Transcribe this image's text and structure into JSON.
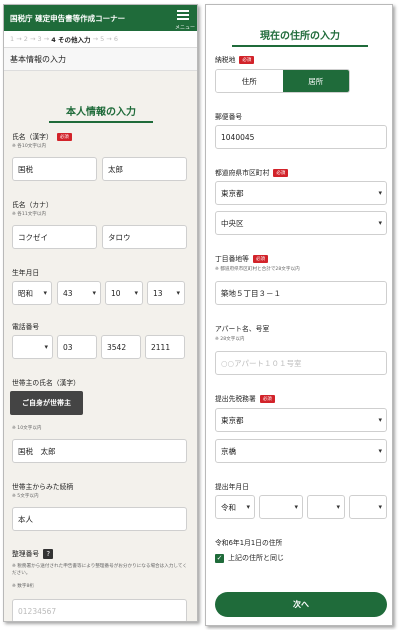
{
  "header": {
    "title": "国税庁 確定申告書等作成コーナー",
    "menu_label": "メニュー"
  },
  "steps": {
    "s1": "1",
    "s2": "2",
    "s3": "3",
    "current": "4 その他入力",
    "s5": "5",
    "s6": "6"
  },
  "section_title": "基本情報の入力",
  "left": {
    "heading": "本人情報の入力",
    "required_badge": "必須",
    "name_kanji": {
      "label": "氏名（漢字）",
      "note": "※ 各10文字以内",
      "last": "国税",
      "first": "太郎"
    },
    "name_kana": {
      "label": "氏名（カナ）",
      "note": "※ 各11文字以内",
      "last": "コクゼイ",
      "first": "タロウ"
    },
    "birthday": {
      "label": "生年月日",
      "era": "昭和",
      "year": "43",
      "month": "10",
      "day": "13"
    },
    "phone": {
      "label": "電話番号",
      "type": "",
      "p1": "03",
      "p2": "3542",
      "p3": "2111"
    },
    "householder": {
      "label": "世帯主の氏名（漢字）",
      "self_button": "ご自身が世帯主",
      "note": "※ 10文字以内",
      "value": "国税　太郎"
    },
    "relation": {
      "label": "世帯主からみた続柄",
      "note": "※ 5文字以内",
      "value": "本人"
    },
    "ref_number": {
      "label": "整理番号",
      "help": "?",
      "note1": "※ 税務署から送付された申告書等により整理番号がお分かりになる場合は入力してください。",
      "note2": "※ 数字8桁",
      "placeholder": "01234567"
    }
  },
  "right": {
    "heading": "現在の住所の入力",
    "required_badge": "必須",
    "tax_place": {
      "label": "納税地",
      "opt1": "住所",
      "opt2": "居所"
    },
    "postal": {
      "label": "郵便番号",
      "value": "1040045"
    },
    "prefecture": {
      "label": "都道府県市区町村",
      "pref": "東京都",
      "city": "中央区"
    },
    "address": {
      "label": "丁目番地等",
      "note": "※ 都道府県市区町村と合計で28文字以内",
      "value": "築地５丁目３－１"
    },
    "apartment": {
      "label": "アパート名、号室",
      "note": "※ 28文字以内",
      "placeholder": "○○アパート１０１号室"
    },
    "tax_office": {
      "label": "提出先税務署",
      "pref": "東京都",
      "office": "京橋"
    },
    "submit_date": {
      "label": "提出年月日",
      "era": "令和",
      "year": "",
      "month": "",
      "day": ""
    },
    "jan1": {
      "label": "令和6年1月1日の住所",
      "check": "✓",
      "check_label": "上記の住所と同じ"
    },
    "next_button": "次へ"
  }
}
